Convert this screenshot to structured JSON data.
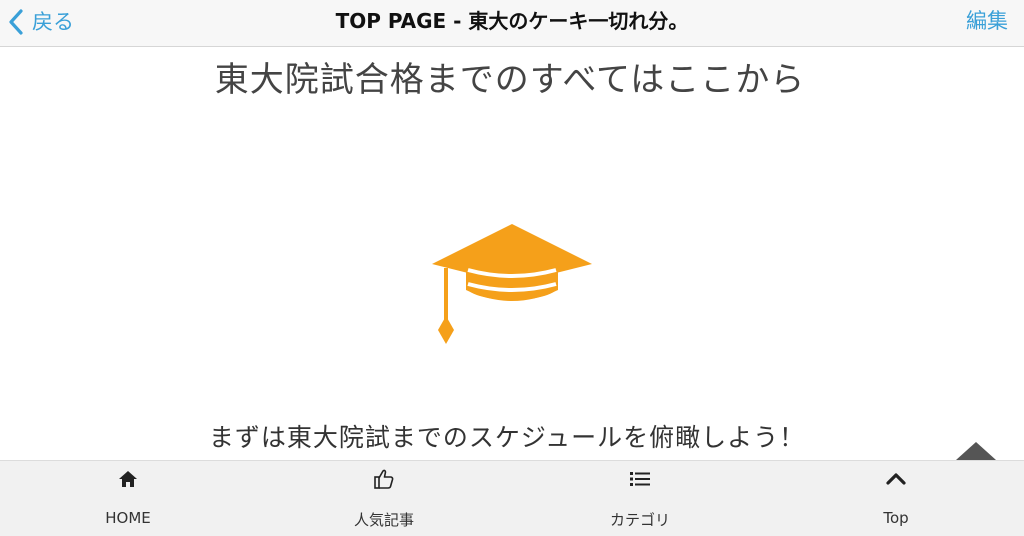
{
  "navbar": {
    "back_label": "戻る",
    "title": "TOP PAGE - 東大のケーキ一切れ分。",
    "edit_label": "編集"
  },
  "main": {
    "headline": "東大院試合格までのすべてはここから",
    "subtext": "まずは東大院試までのスケジュールを俯瞰しよう！",
    "hero_icon": "graduation-cap-icon"
  },
  "tabbar": {
    "tabs": [
      {
        "label": "HOME",
        "icon": "home-icon"
      },
      {
        "label": "人気記事",
        "icon": "thumbs-up-icon"
      },
      {
        "label": "カテゴリ",
        "icon": "list-icon"
      },
      {
        "label": "Top",
        "icon": "chevron-up-icon"
      }
    ]
  },
  "colors": {
    "accent": "#3aa0d8",
    "cap": "#f5a01a",
    "text": "#333333",
    "navbar_bg": "#f7f7f7",
    "tabbar_bg": "#f1f1f1"
  }
}
